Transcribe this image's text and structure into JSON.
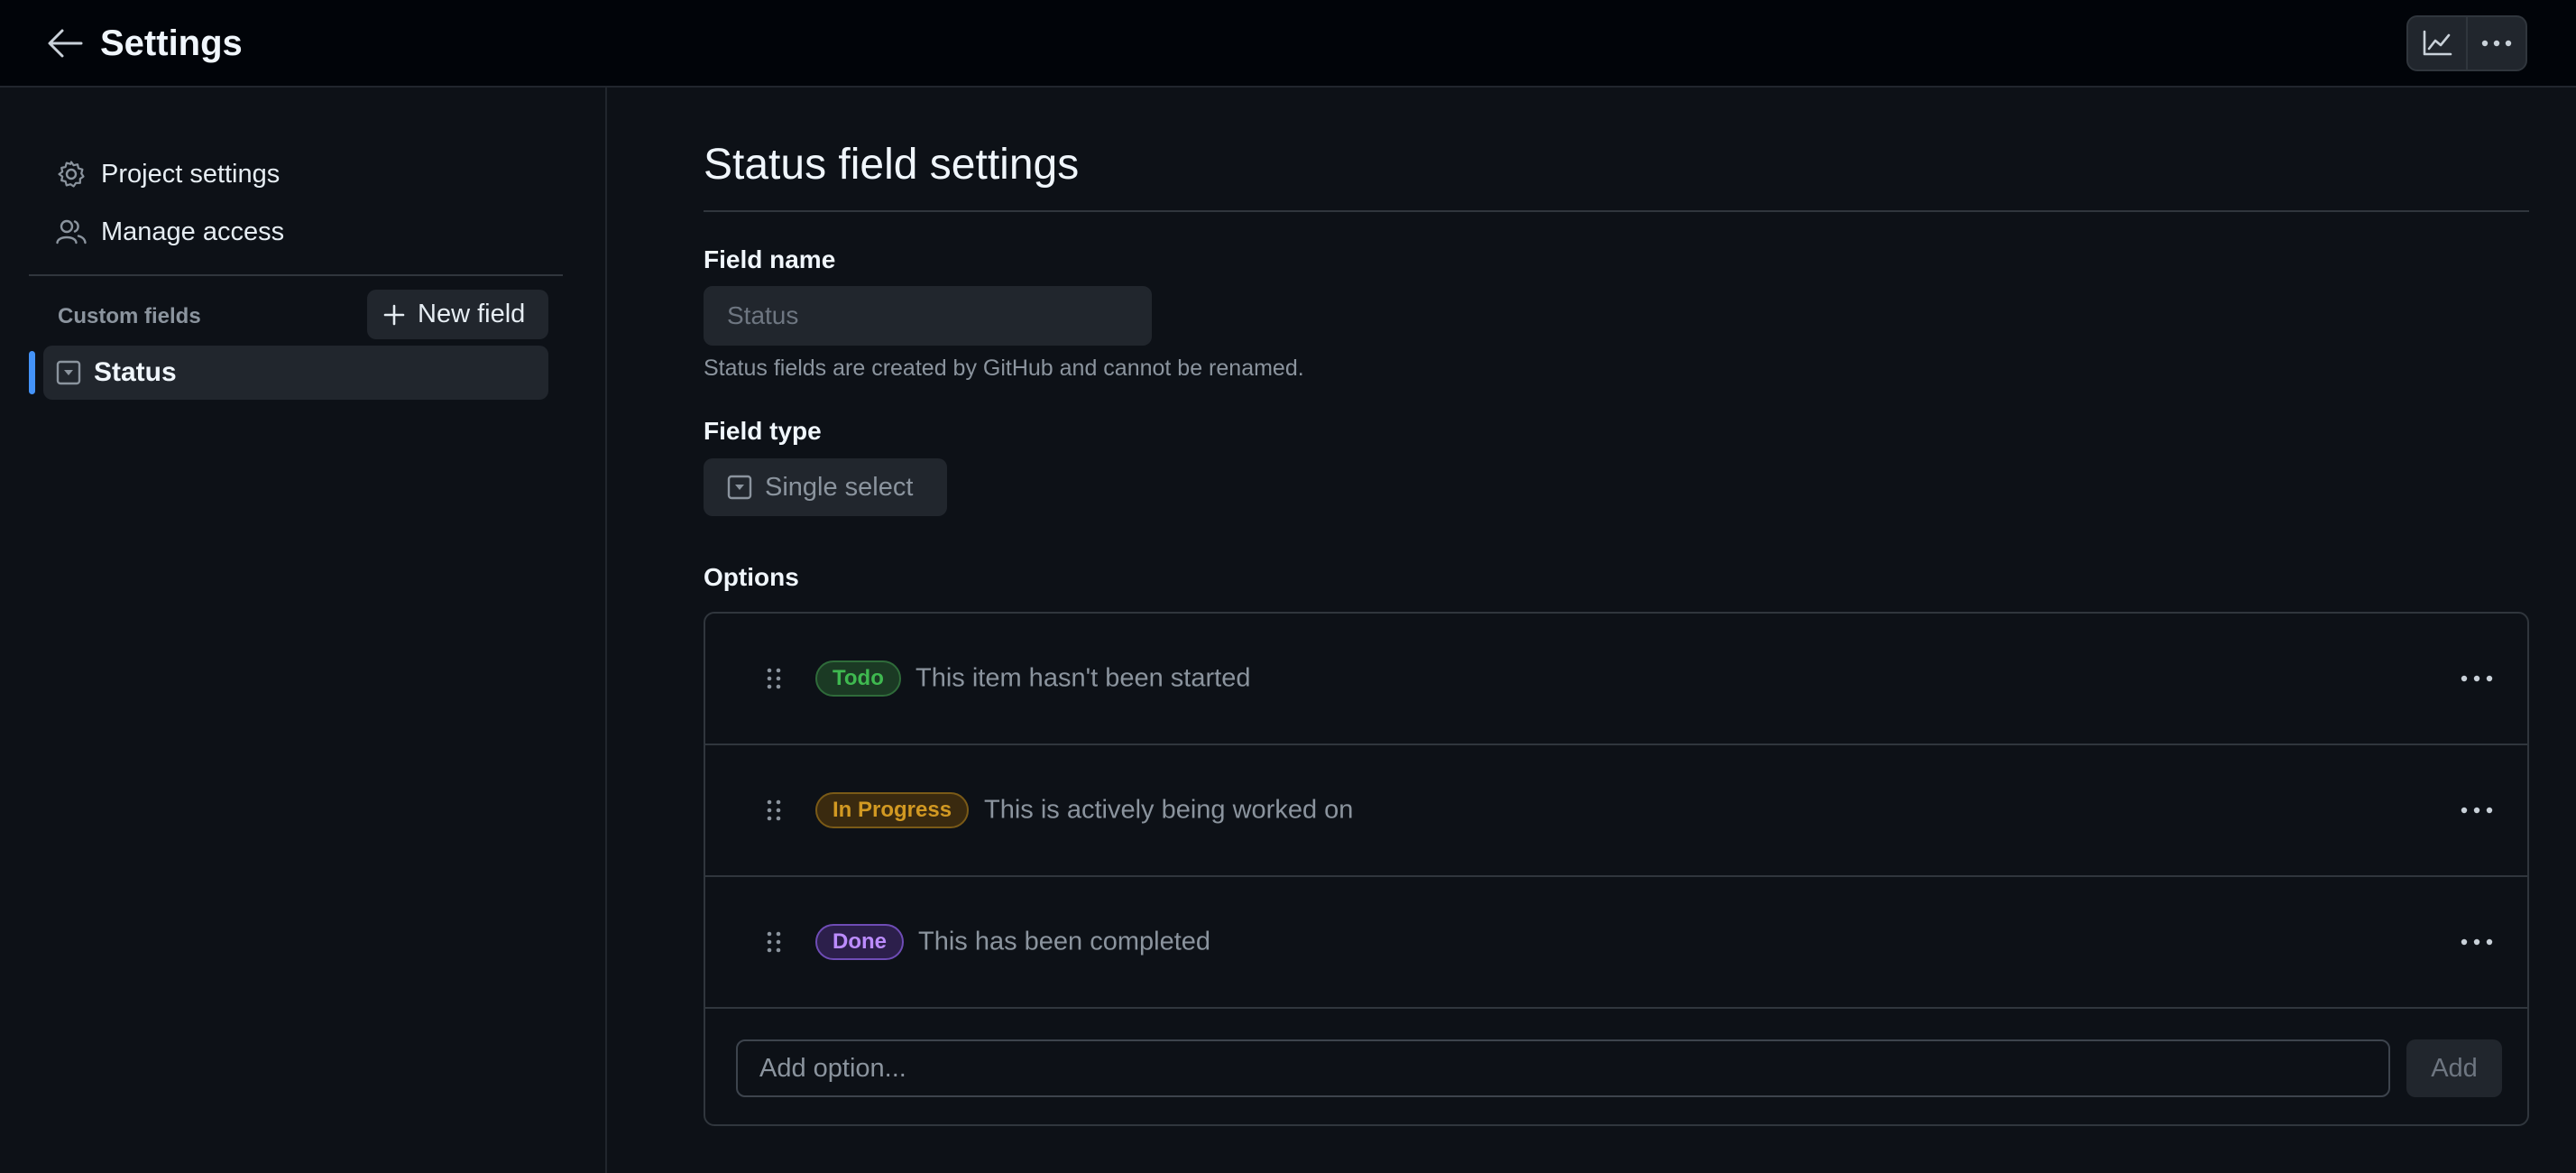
{
  "header": {
    "title": "Settings",
    "back_icon": "arrow-left-icon",
    "actions": [
      "graph-icon",
      "kebab-horizontal-icon"
    ]
  },
  "sidebar": {
    "items": [
      {
        "label": "Project settings",
        "icon": "gear-icon"
      },
      {
        "label": "Manage access",
        "icon": "people-icon"
      }
    ],
    "custom_fields_label": "Custom fields",
    "new_field_label": "New field",
    "fields": [
      {
        "label": "Status",
        "icon": "single-select-icon",
        "active": true
      }
    ]
  },
  "main": {
    "title": "Status field settings",
    "field_name": {
      "label": "Field name",
      "value": "Status",
      "hint": "Status fields are created by GitHub and cannot be renamed."
    },
    "field_type": {
      "label": "Field type",
      "value": "Single select"
    },
    "options": {
      "label": "Options",
      "items": [
        {
          "name": "Todo",
          "description": "This item hasn't been started",
          "color": "#3fb950"
        },
        {
          "name": "In Progress",
          "description": "This is actively being worked on",
          "color": "#d29922"
        },
        {
          "name": "Done",
          "description": "This has been completed",
          "color": "#bc8cff"
        }
      ],
      "add_placeholder": "Add option...",
      "add_button": "Add"
    }
  }
}
